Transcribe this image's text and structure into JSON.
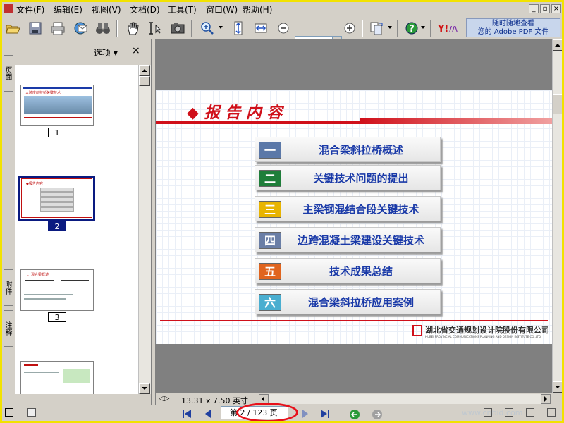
{
  "menu": [
    "文件(F)",
    "编辑(E)",
    "视图(V)",
    "文档(D)",
    "工具(T)",
    "窗口(W)",
    "帮助(H)"
  ],
  "window_buttons": [
    "_",
    "▫",
    "×"
  ],
  "toolbar": {
    "zoom_value": "50%",
    "adobe_promo_line1": "随时随地查看",
    "adobe_promo_line2": "您的 Adobe PDF 文件",
    "icons": [
      "open-folder-icon",
      "save-icon",
      "print-icon",
      "email-icon",
      "search-binoculars-icon",
      "hand-tool-icon",
      "select-text-icon",
      "snapshot-icon",
      "zoom-in-tool-icon",
      "fit-page-icon",
      "fit-width-icon",
      "zoom-out-icon",
      "zoom-in-icon",
      "rotate-pages-icon",
      "help-icon",
      "yahoo-icon"
    ]
  },
  "side_panel": {
    "options_label": "选项 ▾",
    "close_label": "×",
    "tabs": [
      "页面",
      "附件",
      "注释"
    ],
    "thumbnails": [
      {
        "number": "1",
        "selected": false
      },
      {
        "number": "2",
        "selected": true
      },
      {
        "number": "3",
        "selected": false
      }
    ],
    "thumb1_title": "大跨度斜拉桥关键技术",
    "thumb2_title": "◆报告内容",
    "thumb3_title": "一、混合梁概述"
  },
  "slide": {
    "title": "◆ 报 告 内 容",
    "items": [
      {
        "num": "一",
        "text": "混合梁斜拉桥概述",
        "color": "#5b78a8"
      },
      {
        "num": "二",
        "text": "关键技术问题的提出",
        "color": "#1e7e3a"
      },
      {
        "num": "三",
        "text": "主梁钢混结合段关键技术",
        "color": "#e8b400"
      },
      {
        "num": "四",
        "text": "边跨混凝土梁建设关键技术",
        "color": "#6a7ea6"
      },
      {
        "num": "五",
        "text": "技术成果总结",
        "color": "#e0641e"
      },
      {
        "num": "六",
        "text": "混合梁斜拉桥应用案例",
        "color": "#4aaed0"
      }
    ],
    "company": "湖北省交通规划设计院股份有限公司",
    "company_en": "HUBEI PROVINCIAL COMMUNICATIONS PLANNING AND DESIGN INSTITUTE CO.,LTD",
    "accent_color": "#d0101a",
    "title_color": "#d0101a"
  },
  "doc_status": {
    "page_size": "13.31 x 7.50 英寸"
  },
  "bottom": {
    "page_text": "第 2 / 123 页",
    "watermark": "www.cnbid.com"
  }
}
